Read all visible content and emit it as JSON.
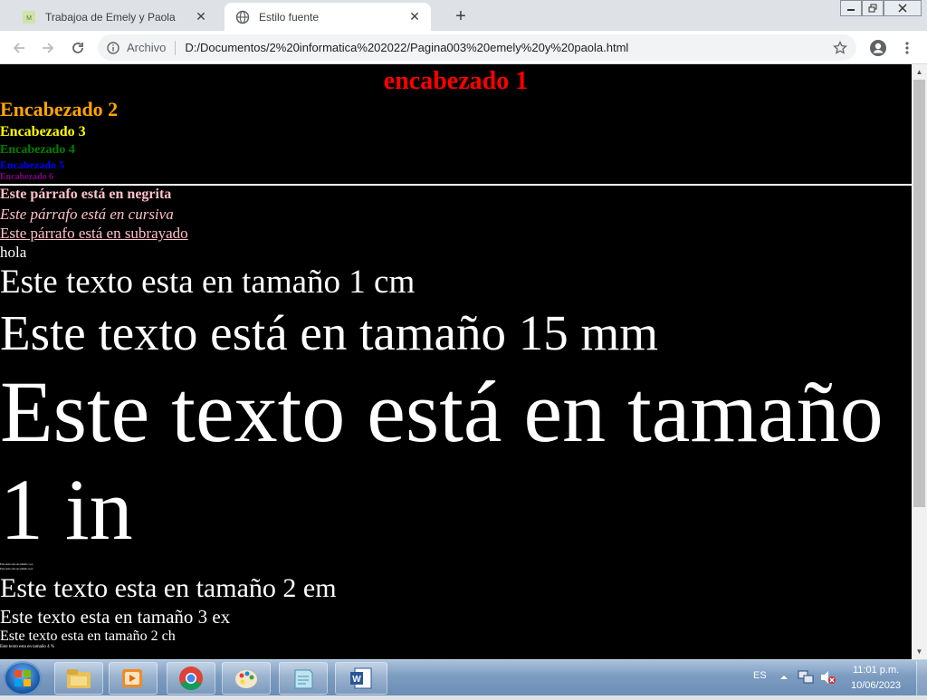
{
  "browser": {
    "tabs": [
      {
        "title": "Trabajoa de Emely y Paola",
        "active": false
      },
      {
        "title": "Estilo fuente",
        "active": true
      }
    ],
    "new_tab_label": "+",
    "address": {
      "security_chip": "Archivo",
      "url": "D:/Documentos/2%20informatica%202022/Pagina003%20emely%20y%20paola.html"
    }
  },
  "page": {
    "h1": "encabezado 1",
    "h2": "Encabezado 2",
    "h3": "Encabezado 3",
    "h4": "Encabezado 4",
    "h5": "Encabezado 5",
    "h6": "Encabezado 6",
    "p_bold": "Este párrafo está en negrita",
    "p_italic": "Este párrafo está en cursiva",
    "p_underline": "Este párrafo está en subrayado",
    "p_hola": "hola",
    "p_1cm": "Este texto esta en tamaño 1 cm",
    "p_15mm": "Este texto está en tamaño 15 mm",
    "p_1in": "Este texto está en tamaño 1 in",
    "p_tiny1": "Este texto esta en tamaño 1 px",
    "p_tiny2": "Este texto esta en tamaño 2 px",
    "p_2em": "Este texto esta en tamaño 2 em",
    "p_3ex": "Este texto esta en tamaño 3 ex",
    "p_2ch": "Este texto esta en tamaño 2 ch",
    "p_4pct": "Este texto esta en tamaño 4 %"
  },
  "colors": {
    "h1": "#ff0000",
    "h2": "#ffa500",
    "h3": "#ffff00",
    "h4": "#008000",
    "h5": "#0000ff",
    "h6": "#800080",
    "styled_paragraphs": "#ffc0cb",
    "page_background": "#000000"
  },
  "taskbar": {
    "language": "ES",
    "time": "11:01 p.m.",
    "date": "10/06/2023",
    "pinned": [
      "explorer-icon",
      "media-player-icon",
      "chrome-icon",
      "paint-icon",
      "notepad-icon",
      "word-icon"
    ]
  }
}
